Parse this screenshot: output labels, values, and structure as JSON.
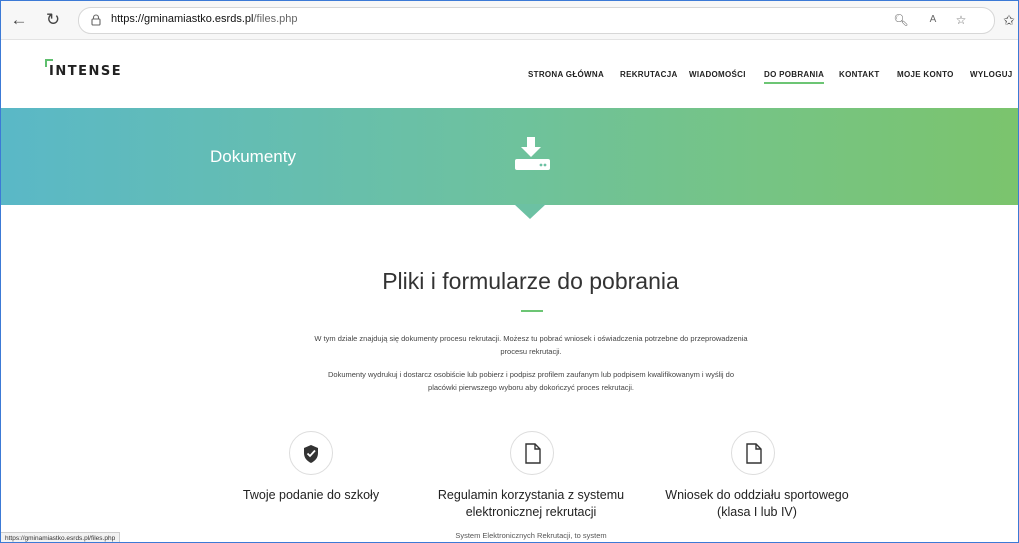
{
  "browser": {
    "url_domain": "https://gminamiastko.esrds.pl",
    "url_path": "/files.php"
  },
  "header": {
    "logo": "INTENSE",
    "menu": [
      {
        "label": "STRONA GŁÓWNA"
      },
      {
        "label": "REKRUTACJA"
      },
      {
        "label": "WIADOMOŚCI"
      },
      {
        "label": "DO POBRANIA"
      },
      {
        "label": "KONTAKT"
      },
      {
        "label": "MOJE KONTO"
      },
      {
        "label": "WYLOGUJ"
      }
    ],
    "active_item": "DO POBRANIA",
    "accent_color": "#6cc574"
  },
  "hero": {
    "title": "Dokumenty",
    "icon": "download-icon",
    "gradient_start": "#5ab8c7",
    "gradient_end": "#7bc46d"
  },
  "main": {
    "title": "Pliki i formularze do pobrania",
    "paragraph1_line1": "W tym dziale znajdują się dokumenty procesu rekrutacji. Możesz tu pobrać wniosek i oświadczenia potrzebne do przeprowadzenia",
    "paragraph1_line2": "procesu rekrutacji.",
    "paragraph2_line1": "Dokumenty wydrukuj i dostarcz osobiście lub pobierz i podpisz profilem zaufanym lub podpisem kwalifikowanym i wyślij do",
    "paragraph2_line2": "placówki pierwszego wyboru aby dokończyć proces rekrutacji."
  },
  "features": [
    {
      "icon": "shield-check-icon",
      "title_line1": "Twoje podanie do szkoły",
      "title_line2": "",
      "desc": ""
    },
    {
      "icon": "document-icon",
      "title_line1": "Regulamin korzystania z systemu",
      "title_line2": "elektronicznej rekrutacji",
      "desc": "System Elektronicznych Rekrutacji, to system"
    },
    {
      "icon": "document-icon",
      "title_line1": "Wniosek do oddziału sportowego",
      "title_line2": "(klasa I lub IV)",
      "desc": ""
    }
  ],
  "status_url": "https://gminamiastko.esrds.pl/files.php"
}
